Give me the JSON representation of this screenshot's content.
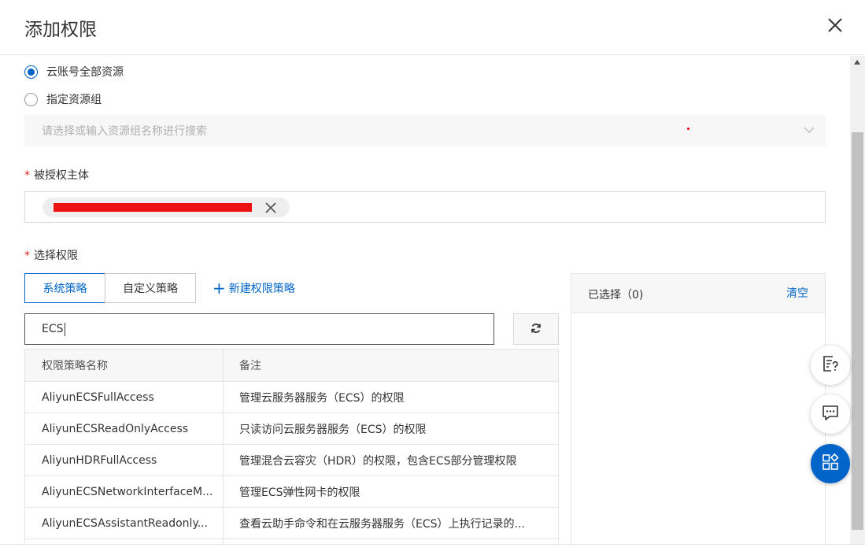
{
  "header": {
    "title": "添加权限",
    "close_icon": "close-icon"
  },
  "scope": {
    "options": [
      {
        "label": "云账号全部资源",
        "checked": true
      },
      {
        "label": "指定资源组",
        "checked": false
      }
    ],
    "resource_group_select": {
      "placeholder": "请选择或输入资源组名称进行搜索",
      "icon": "chevron-down-icon"
    }
  },
  "principal": {
    "label": "被授权主体",
    "required_mark": "*",
    "tag_value": "",
    "tag_close_icon": "close-icon"
  },
  "permissions": {
    "label": "选择权限",
    "required_mark": "*",
    "tabs": [
      {
        "label": "系统策略",
        "active": true
      },
      {
        "label": "自定义策略",
        "active": false
      }
    ],
    "new_policy": {
      "plus": "+",
      "label": "新建权限策略"
    },
    "search_value": "ECS",
    "refresh_icon": "refresh-icon",
    "table": {
      "columns": [
        "权限策略名称",
        "备注"
      ],
      "rows": [
        {
          "name": "AliyunECSFullAccess",
          "note": "管理云服务器服务（ECS）的权限"
        },
        {
          "name": "AliyunECSReadOnlyAccess",
          "note": "只读访问云服务器服务（ECS）的权限"
        },
        {
          "name": "AliyunHDRFullAccess",
          "note": "管理混合云容灾（HDR）的权限，包含ECS部分管理权限"
        },
        {
          "name": "AliyunECSNetworkInterfaceM...",
          "note": "管理ECS弹性网卡的权限"
        },
        {
          "name": "AliyunECSAssistantReadonly...",
          "note": "查看云助手命令和在云服务器服务（ECS）上执行记录的..."
        }
      ]
    }
  },
  "selected": {
    "title": "已选择（0)",
    "clear_label": "清空"
  },
  "floating": [
    {
      "icon": "doc-help-icon"
    },
    {
      "icon": "chat-icon"
    },
    {
      "icon": "apps-icon"
    }
  ],
  "colors": {
    "accent": "#0064c8",
    "required": "#e2231a",
    "redaction": "#ee1111"
  }
}
